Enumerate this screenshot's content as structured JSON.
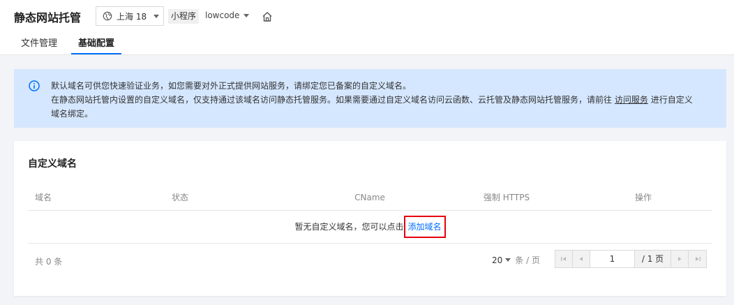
{
  "header": {
    "title": "静态网站托管",
    "region_label": "上海 18",
    "env_tag": "小程序",
    "env_name": "lowcode"
  },
  "tabs": [
    {
      "label": "文件管理",
      "active": false
    },
    {
      "label": "基础配置",
      "active": true
    }
  ],
  "notice": {
    "line1": "默认域名可供您快速验证业务，如您需要对外正式提供网站服务，请绑定您已备案的自定义域名。",
    "line2_pre": "在静态网站托管内设置的自定义域名，仅支持通过该域名访问静态托管服务。如果需要通过自定义域名访问云函数、云托管及静态网站托管服务，请前往",
    "line2_link": "访问服务",
    "line2_post": "进行自定义",
    "line3": "域名绑定。"
  },
  "card": {
    "title": "自定义域名",
    "columns": [
      "域名",
      "状态",
      "CName",
      "强制 HTTPS",
      "操作"
    ],
    "empty_text": "暂无自定义域名，您可以点击",
    "empty_link": "添加域名",
    "total_text": "共 0 条",
    "page_size": "20",
    "page_size_unit": "条 / 页",
    "current_page": "1",
    "total_pages": "/ 1 页"
  },
  "colors": {
    "accent": "#006eff",
    "notice_bg": "#d5e7ff",
    "highlight_border": "#e5000e"
  }
}
